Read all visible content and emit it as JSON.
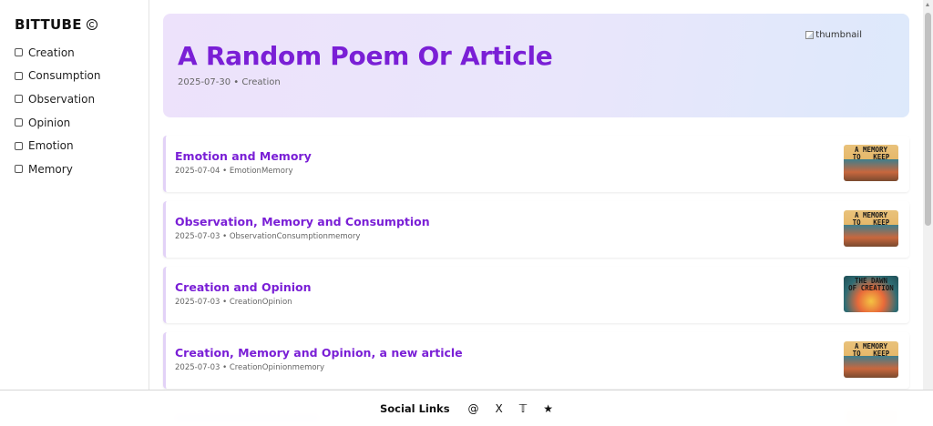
{
  "sidebar": {
    "brand": "BITTUBE",
    "filters": [
      {
        "label": "Creation"
      },
      {
        "label": "Consumption"
      },
      {
        "label": "Observation"
      },
      {
        "label": "Opinion"
      },
      {
        "label": "Emotion"
      },
      {
        "label": "Memory"
      }
    ]
  },
  "hero": {
    "title": "A Random Poem Or Article",
    "meta": "2025-07-30 • Creation",
    "thumbnail_alt": "thumbnail"
  },
  "articles": [
    {
      "title": "Emotion and Memory",
      "meta": "2025-07-04 • EmotionMemory",
      "thumb_text": "A MEMORY\nTO    KEEP",
      "thumb_style": "memory"
    },
    {
      "title": "Observation, Memory and Consumption",
      "meta": "2025-07-03 • ObservationConsumptionmemory",
      "thumb_text": "A MEMORY\nTO    KEEP",
      "thumb_style": "memory"
    },
    {
      "title": "Creation and Opinion",
      "meta": "2025-07-03 • CreationOpinion",
      "thumb_text": "THE DAWN\nOF CREATION",
      "thumb_style": "dawn"
    },
    {
      "title": "Creation, Memory and Opinion, a new article",
      "meta": "2025-07-03 • CreationOpinionmemory",
      "thumb_text": "A MEMORY\nTO    KEEP",
      "thumb_style": "memory"
    }
  ],
  "footer": {
    "label": "Social Links",
    "links": [
      {
        "icon": "@",
        "name": "threads-icon"
      },
      {
        "icon": "X",
        "name": "x-icon"
      },
      {
        "icon": "𝕋",
        "name": "tumblr-icon"
      },
      {
        "icon": "★",
        "name": "star-icon"
      }
    ]
  }
}
